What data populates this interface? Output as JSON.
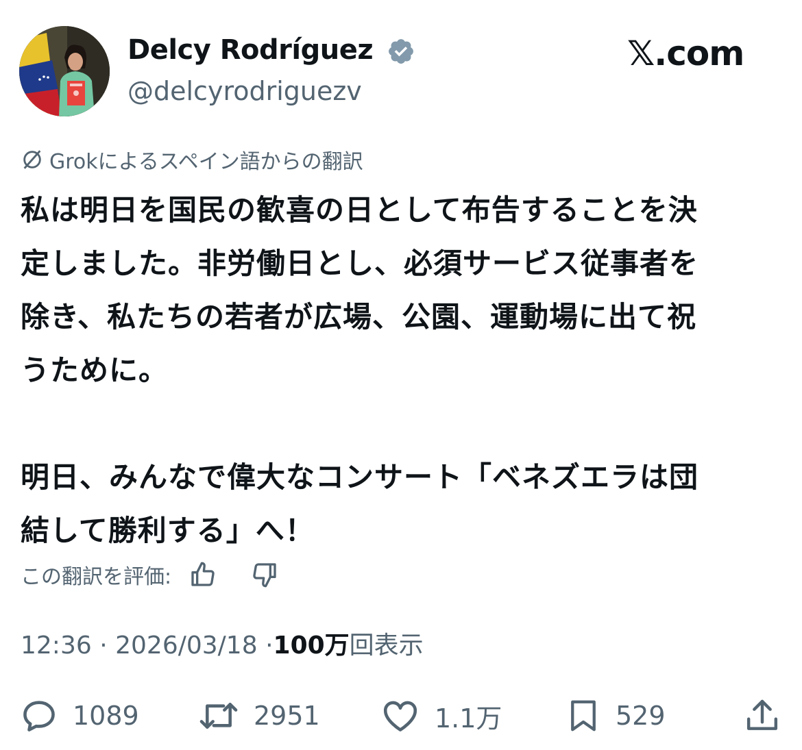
{
  "author": {
    "name": "Delcy Rodríguez",
    "handle": "@delcyrodriguezv",
    "verified_icon": "verified-badge-icon",
    "verified_color": "#829aab"
  },
  "brand": {
    "logo_text": "𝕏.com"
  },
  "translation": {
    "icon": "grok-icon",
    "label": "Grokによるスペイン語からの翻訳"
  },
  "tweet": {
    "paragraph1": [
      "私は明日を国民の歓喜の日として布告することを決",
      "定しました。非労働日とし、必須サービス従事者を",
      "除き、私たちの若者が広場、公園、運動場に出て祝",
      "うために。"
    ],
    "paragraph2": [
      "明日、みんなで偉大なコンサート「ベネズエラは団",
      "結して勝利する」へ！"
    ]
  },
  "rating": {
    "label": "この翻訳を評価:",
    "up_icon": "thumbs-up-icon",
    "down_icon": "thumbs-down-icon"
  },
  "meta": {
    "time": "12:36",
    "separator": "·",
    "date": "2026/03/18",
    "views_number": "100万",
    "views_suffix": "回表示"
  },
  "actions": {
    "reply_count": "1089",
    "retweet_count": "2951",
    "like_count": "1.1万",
    "bookmark_count": "529"
  },
  "colors": {
    "text": "#0f1419",
    "secondary": "#536471",
    "background": "#ffffff"
  }
}
